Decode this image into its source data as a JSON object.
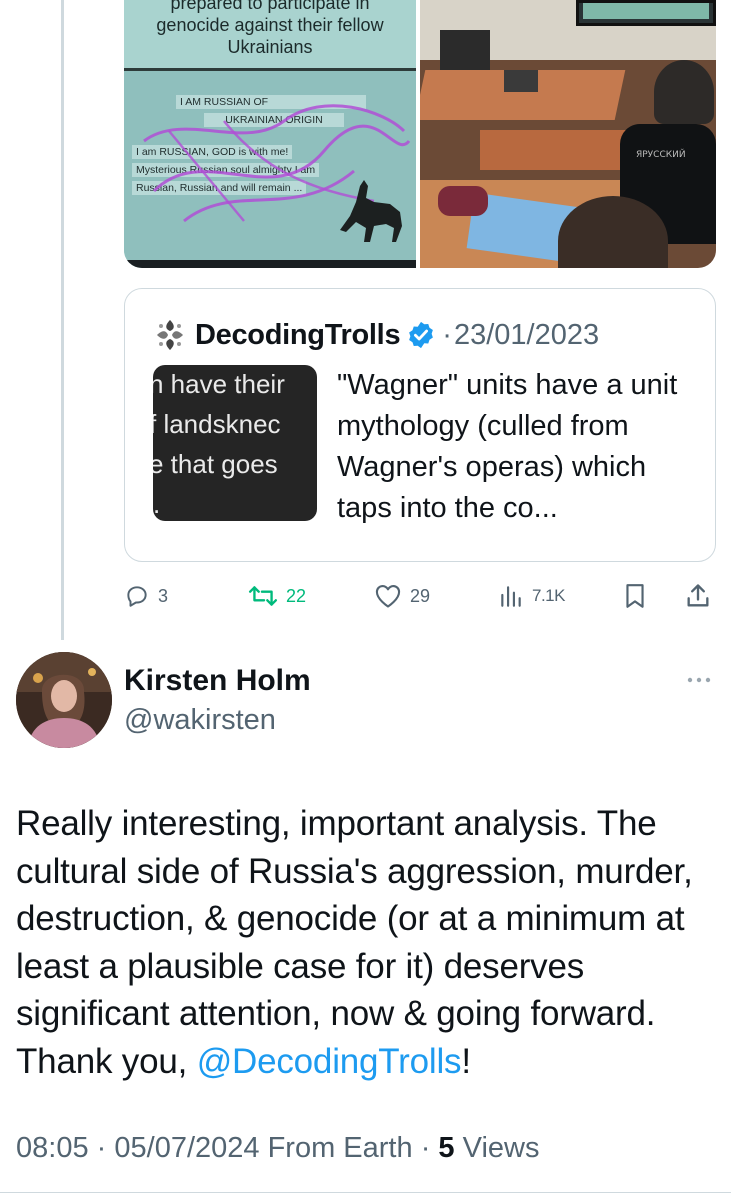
{
  "media": {
    "left_slide": {
      "caption_line1": "prepared to participate in",
      "caption_line2": "genocide against their fellow",
      "caption_line3": "Ukrainians",
      "slide_line1": "I AM RUSSIAN OF",
      "slide_line2": "UKRAINIAN ORIGIN",
      "slide_line3": "I am RUSSIAN, GOD is with me!",
      "slide_line4": "Mysterious Russian soul almighty I am",
      "slide_line5": "Russian, Russian and will remain ..."
    },
    "right_photo": {
      "shirt_text": "ЯРУССКИЙ"
    }
  },
  "quote": {
    "name": "DecodingTrolls",
    "date": "23/01/2023",
    "separator": "·",
    "thumb_lines": [
      "n have their",
      "f landsknec",
      "e that goes",
      "."
    ],
    "text": "\"Wagner\" units have a unit mythology (culled from Wagner's operas) which taps into the co..."
  },
  "actions": {
    "replies": "3",
    "reposts": "22",
    "likes": "29",
    "views": "7.1K"
  },
  "reply": {
    "name": "Kirsten Holm",
    "handle": "@wakirsten",
    "text_before": "Really interesting, important analysis.  The cultural side of Russia's aggression, murder, destruction, & genocide (or at a minimum at least a plausible case for it) deserves significant attention, now & going forward. Thank you, ",
    "mention": "@DecodingTrolls",
    "text_after": "!",
    "time": "08:05",
    "date": "05/07/2024",
    "source": "From Earth",
    "sep": "·",
    "views_count": "5",
    "views_label": "Views"
  },
  "colors": {
    "accent": "#1d9bf0",
    "repost_green": "#00ba7c",
    "secondary_text": "#536471",
    "border": "#cfd9de"
  },
  "icons": [
    "reply-icon",
    "repost-icon",
    "like-icon",
    "views-icon",
    "bookmark-icon",
    "share-icon",
    "more-icon",
    "verified-icon"
  ]
}
